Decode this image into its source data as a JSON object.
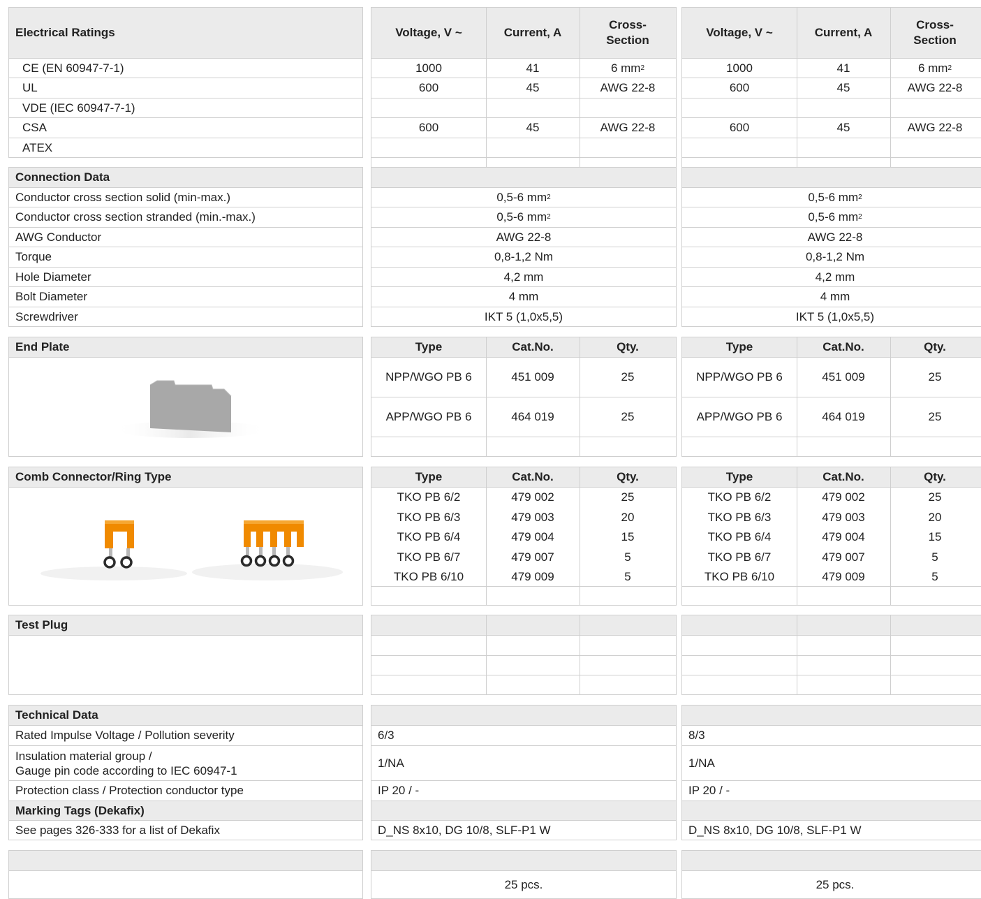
{
  "electrical": {
    "title": "Electrical Ratings",
    "headers": [
      "Voltage, V ~",
      "Current, A",
      "Cross-\nSection"
    ],
    "rows": [
      {
        "label": "CE (EN 60947-7-1)",
        "v": "1000",
        "a": "41",
        "cs": "6 mm²"
      },
      {
        "label": "UL",
        "v": "600",
        "a": "45",
        "cs": "AWG 22-8"
      },
      {
        "label": "VDE (IEC 60947-7-1)",
        "v": "",
        "a": "",
        "cs": ""
      },
      {
        "label": "CSA",
        "v": "600",
        "a": "45",
        "cs": "AWG 22-8"
      },
      {
        "label": "ATEX",
        "v": "",
        "a": "",
        "cs": ""
      }
    ]
  },
  "connection": {
    "title": "Connection Data",
    "rows": [
      {
        "label": "Conductor cross section solid (min-max.)",
        "value": "0,5-6 mm²"
      },
      {
        "label": "Conductor cross section stranded (min.-max.)",
        "value": "0,5-6 mm²"
      },
      {
        "label": "AWG Conductor",
        "value": "AWG 22-8"
      },
      {
        "label": "Torque",
        "value": "0,8-1,2 Nm"
      },
      {
        "label": "Hole Diameter",
        "value": "4,2 mm"
      },
      {
        "label": "Bolt Diameter",
        "value": "4 mm"
      },
      {
        "label": "Screwdriver",
        "value": "IKT 5 (1,0x5,5)"
      }
    ]
  },
  "endplate": {
    "title": "End Plate",
    "headers": [
      "Type",
      "Cat.No.",
      "Qty."
    ],
    "rows": [
      {
        "type": "NPP/WGO PB 6",
        "cat": "451 009",
        "qty": "25"
      },
      {
        "type": "APP/WGO PB 6",
        "cat": "464 019",
        "qty": "25"
      }
    ]
  },
  "comb": {
    "title": "Comb Connector/Ring Type",
    "headers": [
      "Type",
      "Cat.No.",
      "Qty."
    ],
    "rows": [
      {
        "type": "TKO PB 6/2",
        "cat": "479 002",
        "qty": "25"
      },
      {
        "type": "TKO PB 6/3",
        "cat": "479 003",
        "qty": "20"
      },
      {
        "type": "TKO PB 6/4",
        "cat": "479 004",
        "qty": "15"
      },
      {
        "type": "TKO PB 6/7",
        "cat": "479 007",
        "qty": "5"
      },
      {
        "type": "TKO PB 6/10",
        "cat": "479 009",
        "qty": "5"
      }
    ]
  },
  "testplug": {
    "title": "Test Plug"
  },
  "technical": {
    "title": "Technical Data",
    "rows": [
      {
        "label": "Rated Impulse Voltage / Pollution severity",
        "col1": "6/3",
        "col2": "8/3"
      },
      {
        "label": "Insulation material group /\nGauge pin code according to IEC 60947-1",
        "col1": "1/NA",
        "col2": "1/NA"
      },
      {
        "label": "Protection class / Protection conductor type",
        "col1": "IP 20 / -",
        "col2": "IP 20 / -"
      }
    ],
    "marking_title": "Marking Tags (Dekafix)",
    "marking_label": "See pages 326-333 for a list of Dekafix",
    "marking_col1": "D_NS 8x10, DG 10/8, SLF-P1 W",
    "marking_col2": "D_NS 8x10, DG 10/8, SLF-P1 W"
  },
  "packing": {
    "col1": "25 pcs.",
    "col2": "25 pcs."
  },
  "colors": {
    "header_bg": "#ebebeb",
    "border": "#cfcfcf",
    "endplate": "#a8a8a8",
    "comb": "#f08a00"
  }
}
